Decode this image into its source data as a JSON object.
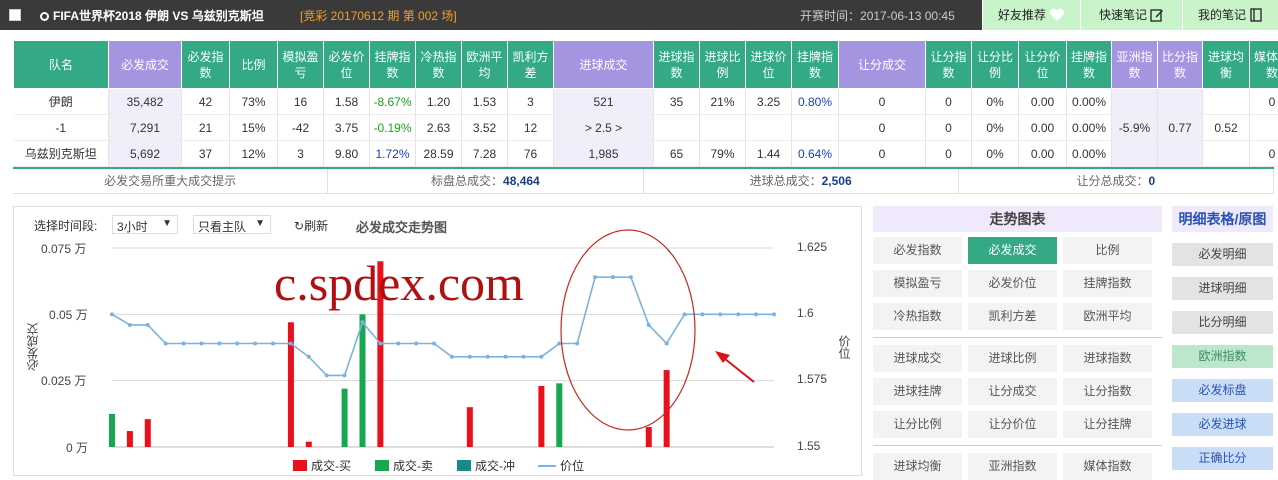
{
  "header": {
    "match": "FIFA世界杯2018  伊朗  VS 乌兹别克斯坦",
    "lottery": "[竞彩 20170612 期 第 002 场]",
    "kickoff_label": "开赛时间：",
    "kickoff_time": "2017-06-13 00:45",
    "buttons": [
      "好友推荐",
      "快速笔记",
      "我的笔记"
    ]
  },
  "table": {
    "columns": [
      "队名",
      "必发成交",
      "必发指数",
      "比例",
      "模拟盈亏",
      "必发价位",
      "挂牌指数",
      "冷热指数",
      "欧洲平均",
      "凯利方差",
      "进球成交",
      "进球指数",
      "进球比例",
      "进球价位",
      "挂牌指数",
      "让分成交",
      "让分指数",
      "让分比例",
      "让分价位",
      "挂牌指数",
      "亚洲指数",
      "比分指数",
      "进球均衡",
      "媒体指数"
    ],
    "rows": [
      [
        "伊朗",
        "35,482",
        "42",
        "73%",
        "16",
        "1.58",
        "-8.67%",
        "1.20",
        "1.53",
        "3",
        "521",
        "35",
        "21%",
        "3.25",
        "0.80%",
        "0",
        "0",
        "0%",
        "0.00",
        "0.00%",
        "",
        "",
        "",
        "0"
      ],
      [
        "-1",
        "7,291",
        "21",
        "15%",
        "-42",
        "3.75",
        "-0.19%",
        "2.63",
        "3.52",
        "12",
        "> 2.5 >",
        "",
        "",
        "",
        "",
        "0",
        "0",
        "0%",
        "0.00",
        "0.00%",
        "-5.9%",
        "0.77",
        "0.52",
        ""
      ],
      [
        "乌兹别克斯坦",
        "5,692",
        "37",
        "12%",
        "3",
        "9.80",
        "1.72%",
        "28.59",
        "7.28",
        "76",
        "1,985",
        "65",
        "79%",
        "1.44",
        "0.64%",
        "0",
        "0",
        "0%",
        "0.00",
        "0.00%",
        "",
        "",
        "",
        "0"
      ]
    ]
  },
  "summary": {
    "hint": "必发交易所重大成交提示",
    "total_label": "标盘总成交：",
    "total": "48,464",
    "goal_label": "进球总成交：",
    "goal": "2,506",
    "handicap_label": "让分总成交：",
    "handicap": "0"
  },
  "chart_controls": {
    "period_label": "选择时间段:",
    "period_value": "3小时",
    "team_value": "只看主队",
    "refresh": "刷新",
    "title": "必发成交走势图"
  },
  "chart_data": {
    "type": "bar",
    "title": "必发成交走势图",
    "ylabel": "必发成交",
    "y2label": "价位",
    "yticks": [
      "0.075 万",
      "0.05 万",
      "0.025 万",
      "0 万"
    ],
    "y2ticks": [
      "1.625",
      "1.6",
      "1.575",
      "1.55"
    ],
    "ylim": [
      0,
      0.075
    ],
    "y2lim": [
      1.55,
      1.625
    ],
    "legend": [
      "成交-买",
      "成交-卖",
      "成交-冲",
      "价位"
    ],
    "colors": {
      "buy": "#e8101a",
      "sell": "#17a84f",
      "hedge": "#168a86",
      "price": "#7ab3e3"
    },
    "buy": [
      [
        1,
        0.006
      ],
      [
        2,
        0.0105
      ],
      [
        10,
        0.047
      ],
      [
        11,
        0.002
      ],
      [
        15,
        0.07
      ],
      [
        20,
        0.015
      ],
      [
        24,
        0.023
      ],
      [
        30,
        0.0075
      ],
      [
        31,
        0.029
      ]
    ],
    "sell": [
      [
        0,
        0.0125
      ],
      [
        13,
        0.022
      ],
      [
        14,
        0.05
      ],
      [
        25,
        0.024
      ]
    ],
    "price": [
      1.6,
      1.596,
      1.596,
      1.589,
      1.589,
      1.589,
      1.589,
      1.589,
      1.589,
      1.589,
      1.589,
      1.584,
      1.577,
      1.577,
      1.597,
      1.589,
      1.589,
      1.589,
      1.589,
      1.584,
      1.584,
      1.584,
      1.584,
      1.584,
      1.584,
      1.589,
      1.589,
      1.614,
      1.614,
      1.614,
      1.596,
      1.589,
      1.6,
      1.6,
      1.6,
      1.6,
      1.6,
      1.6
    ]
  },
  "watermark": "c.spdex.com",
  "trend_panel": {
    "title": "走势图表",
    "active": "必发成交",
    "group1": [
      "必发指数",
      "必发成交",
      "比例",
      "模拟盈亏",
      "必发价位",
      "挂牌指数",
      "冷热指数",
      "凯利方差",
      "欧洲平均"
    ],
    "group2": [
      "进球成交",
      "进球比例",
      "进球指数",
      "进球挂牌",
      "让分成交",
      "让分指数",
      "让分比例",
      "让分价位",
      "让分挂牌"
    ],
    "group3": [
      "进球均衡",
      "亚洲指数",
      "媒体指数"
    ]
  },
  "detail_panel": {
    "title": "明细表格/原图",
    "items": [
      "必发明细",
      "进球明细",
      "比分明细",
      "欧洲指数",
      "必发标盘",
      "必发进球",
      "正确比分"
    ]
  }
}
